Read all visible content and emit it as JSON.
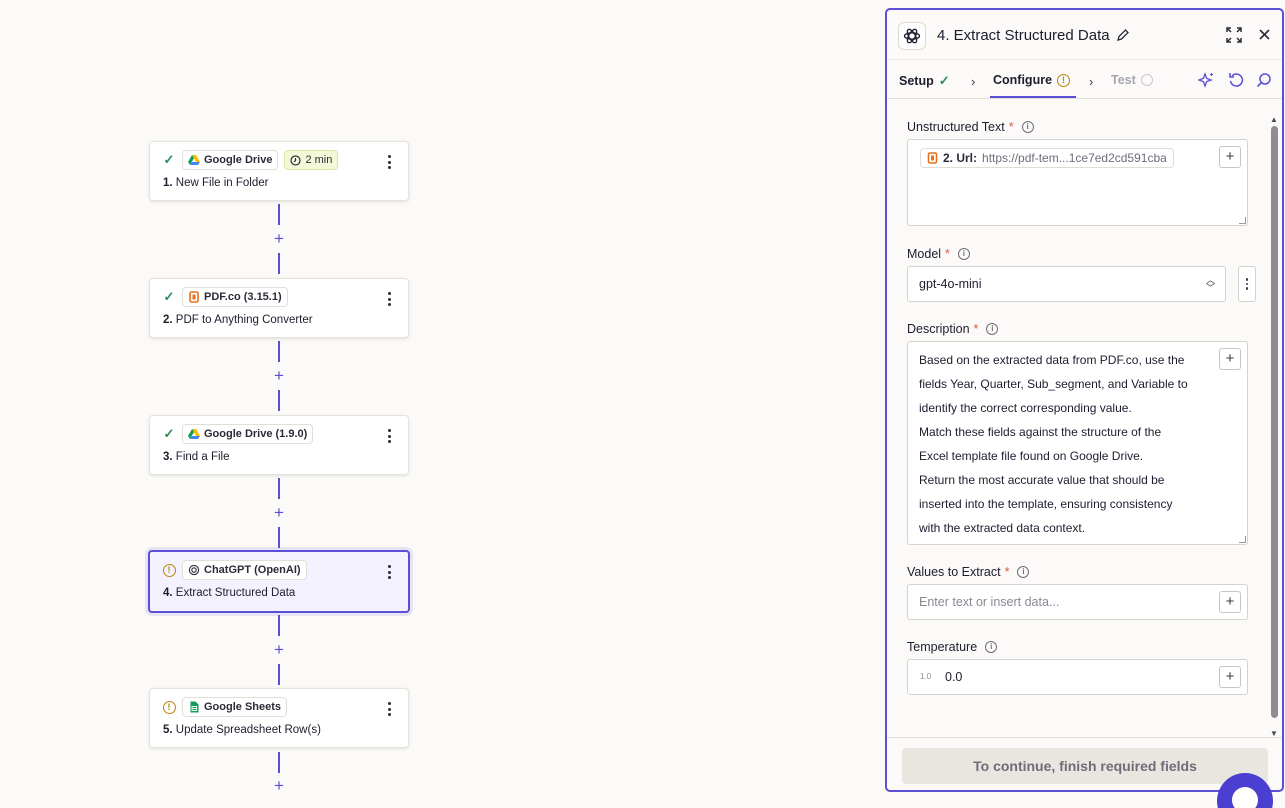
{
  "canvas": {
    "steps": [
      {
        "number": "1.",
        "title": "New File in Folder",
        "app": "Google Drive",
        "badge": "2 min",
        "status": "complete"
      },
      {
        "number": "2.",
        "title": "PDF to Anything Converter",
        "app": "PDF.co (3.15.1)",
        "status": "complete"
      },
      {
        "number": "3.",
        "title": "Find a File",
        "app": "Google Drive (1.9.0)",
        "status": "complete"
      },
      {
        "number": "4.",
        "title": "Extract Structured Data",
        "app": "ChatGPT (OpenAI)",
        "status": "warning",
        "selected": true
      },
      {
        "number": "5.",
        "title": "Update Spreadsheet Row(s)",
        "app": "Google Sheets",
        "status": "warning"
      }
    ]
  },
  "panel": {
    "title": "4. Extract Structured Data",
    "tabs": [
      {
        "label": "Setup",
        "state": "complete"
      },
      {
        "label": "Configure",
        "state": "active-warning"
      },
      {
        "label": "Test",
        "state": "disabled"
      }
    ],
    "fields": {
      "unstructured_text": {
        "label": "Unstructured Text",
        "required": "*",
        "token_label": "2. Url:",
        "token_value": "https://pdf-tem...1ce7ed2cd591cba"
      },
      "model": {
        "label": "Model",
        "required": "*",
        "value": "gpt-4o-mini"
      },
      "description": {
        "label": "Description",
        "required": "*",
        "value": "Based on the extracted data from PDF.co, use the\nfields Year, Quarter, Sub_segment, and Variable to\nidentify the correct corresponding value.\nMatch these fields against the structure of the\nExcel template file found on Google Drive.\nReturn the most accurate value that should be\ninserted into the template, ensuring consistency\nwith the extracted data context."
      },
      "values_to_extract": {
        "label": "Values to Extract",
        "required": "*",
        "placeholder": "Enter text or insert data..."
      },
      "temperature": {
        "label": "Temperature",
        "prefix": "1.0",
        "value": "0.0"
      }
    },
    "footer_button": "To continue, finish required fields"
  },
  "colors": {
    "accent": "#5b4fd6",
    "success": "#2e8b57",
    "warning": "#b8860b",
    "required": "#e0583f"
  }
}
